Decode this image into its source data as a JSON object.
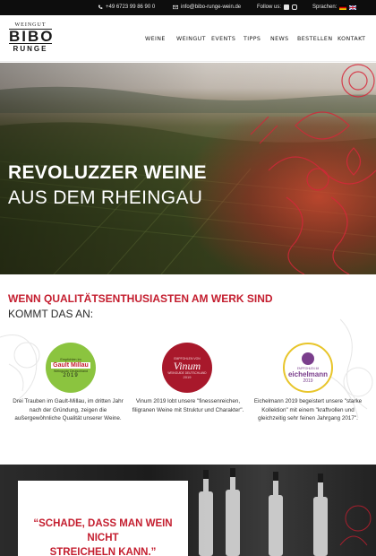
{
  "topbar": {
    "phone": "+49 6723 99 86 90 0",
    "email": "info@bibo-runge-wein.de",
    "follow_label": "Follow us:",
    "language_label": "Sprachen:"
  },
  "logo": {
    "top": "WEINGUT",
    "main": "BIBO",
    "bottom": "RUNGE"
  },
  "nav": {
    "items": [
      "WEINE",
      "WEINGUT",
      "EVENTS",
      "TIPPS",
      "NEWS",
      "BESTELLEN",
      "KONTAKT"
    ]
  },
  "hero": {
    "title": "REVOLUZZER WEINE",
    "subtitle": "AUS DEM RHEINGAU"
  },
  "intro": {
    "heading": "WENN QUALITÄTSENTHUSIASTEN AM WERK SIND",
    "subheading": "KOMMT DAS AN:",
    "badges": [
      {
        "line1": "Empfohlen im",
        "name": "Gault Millau",
        "line2": "Weinguide Deutschland",
        "year": "2019",
        "color": "#8bc43f"
      },
      {
        "line1": "EMPFOHLEN VON",
        "name": "Vinum",
        "line2": "WEINGUIDE DEUTSCHLAND",
        "year": "2019",
        "color": "#a8182b"
      },
      {
        "line1": "EMPFOHLEN IM",
        "name": "eichelmann",
        "line2": "",
        "year": "2019",
        "color": "#7a3e8c"
      }
    ],
    "descriptions": [
      "Drei Trauben im Gault-Millau, im dritten Jahr nach der Gründung, zeigen die außergewöhnliche Qualität unserer Weine.",
      "Vinum 2019 lobt unsere \"finessenreichen, filigranen Weine mit Struktur und Charakter\".",
      "Eichelmann 2019 begeistert unsere \"starke Kollektion\" mit einem \"kraftvollen und gleichzeitig sehr feinen Jahrgang 2017\"."
    ]
  },
  "quote": {
    "line1": "“SCHADE, DASS MAN WEIN NICHT",
    "line2": "STREICHELN KANN.”"
  },
  "colors": {
    "accent": "#c41e2f",
    "dark": "#0d0d0d"
  }
}
